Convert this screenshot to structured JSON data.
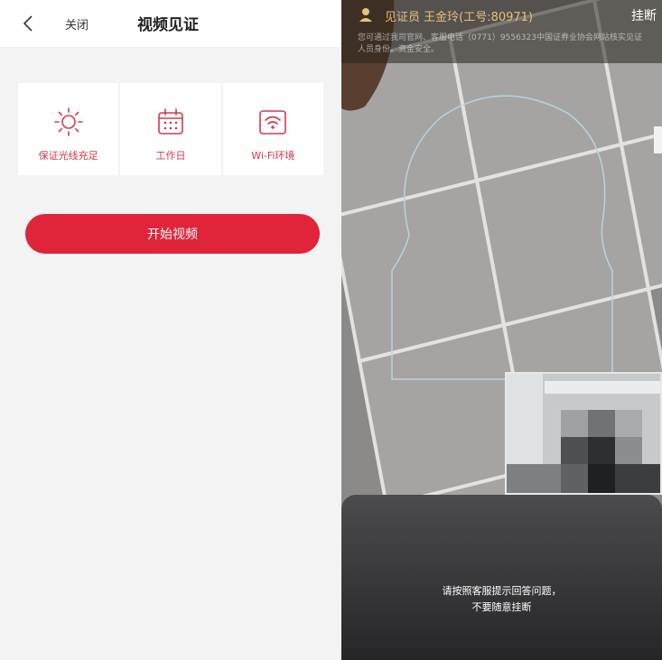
{
  "left": {
    "nav": {
      "back_icon": "chevron-left-icon",
      "close_label": "关闭",
      "title": "视频见证"
    },
    "tips": [
      {
        "icon": "sun-icon",
        "label": "保证光线充足"
      },
      {
        "icon": "calendar-icon",
        "label": "工作日"
      },
      {
        "icon": "wifi-icon",
        "label": "Wi-Fi环境"
      }
    ],
    "start_button_label": "开始视频",
    "colors": {
      "accent": "#e0243a",
      "tip_text": "#d23a4a",
      "background": "#f3f3f3"
    }
  },
  "right": {
    "agent_label": "见证员 王金玲(工号:80971)",
    "hangup_label": "挂断",
    "notice": "您可通过我司官网、客服电话（0771）9556323中国证券业协会网站核实见证人员身份。资金安全。",
    "prompt_line1": "请按照客服提示回答问题，",
    "prompt_line2": "不要随意挂断",
    "colors": {
      "agent_text": "#e8c07a",
      "overlay_top": "#4c4c4e",
      "overlay_bottom": "#262628"
    }
  }
}
